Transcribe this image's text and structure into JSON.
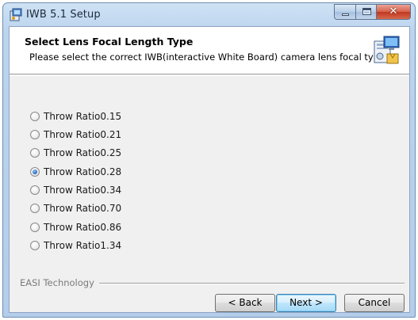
{
  "window": {
    "title": "IWB 5.1 Setup",
    "caption_buttons": {
      "minimize": "minimize",
      "maximize": "maximize",
      "close": "✕"
    }
  },
  "header": {
    "title": "Select Lens Focal Length Type",
    "subtitle": "Please select the correct IWB(interactive White Board) camera lens focal type.",
    "icon": "installer-computer-icon"
  },
  "options": [
    {
      "label": "Throw Ratio0.15",
      "checked": false
    },
    {
      "label": "Throw Ratio0.21",
      "checked": false
    },
    {
      "label": "Throw Ratio0.25",
      "checked": false
    },
    {
      "label": "Throw Ratio0.28",
      "checked": true
    },
    {
      "label": "Throw Ratio0.34",
      "checked": false
    },
    {
      "label": "Throw Ratio0.70",
      "checked": false
    },
    {
      "label": "Throw Ratio0.86",
      "checked": false
    },
    {
      "label": "Throw Ratio1.34",
      "checked": false
    }
  ],
  "footer": {
    "brand": "EASI Technology",
    "back_label": "< Back",
    "next_label": "Next >",
    "cancel_label": "Cancel"
  },
  "colors": {
    "title_bar": "#bcd4ee",
    "close_button": "#c2361f",
    "dialog_bg": "#f0f0f0",
    "radio_selected": "#2f6ec4"
  }
}
